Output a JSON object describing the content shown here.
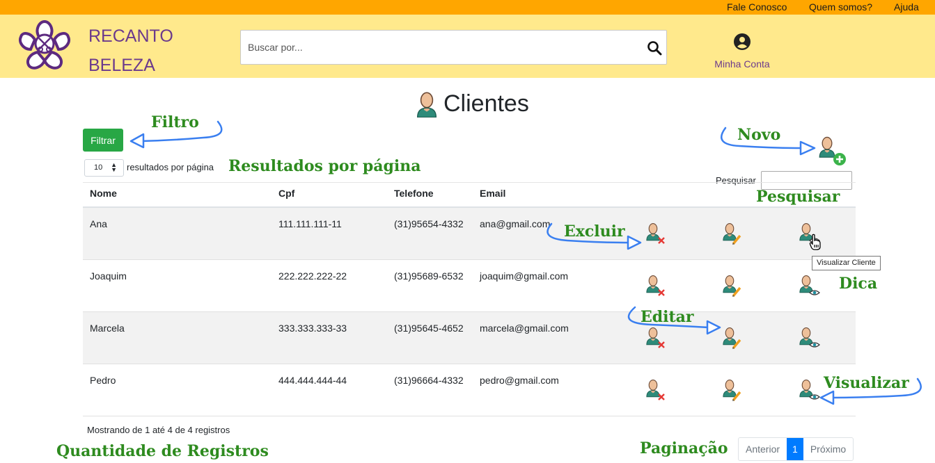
{
  "topbar": {
    "links": [
      "Fale Conosco",
      "Quem somos?",
      "Ajuda"
    ]
  },
  "brand": {
    "line1": "RECANTO",
    "line2": "BELEZA"
  },
  "search": {
    "placeholder": "Buscar por..."
  },
  "account": {
    "label": "Minha Conta"
  },
  "page": {
    "title": "Clientes"
  },
  "controls": {
    "filter_label": "Filtrar",
    "per_page_value": "10",
    "per_page_label": "resultados por página",
    "search_label": "Pesquisar"
  },
  "table": {
    "columns": [
      "Nome",
      "Cpf",
      "Telefone",
      "Email"
    ],
    "rows": [
      {
        "nome": "Ana",
        "cpf": "111.111.111-11",
        "telefone": "(31)95654-4332",
        "email": "ana@gmail.com"
      },
      {
        "nome": "Joaquim",
        "cpf": "222.222.222-22",
        "telefone": "(31)95689-6532",
        "email": "joaquim@gmail.com"
      },
      {
        "nome": "Marcela",
        "cpf": "333.333.333-33",
        "telefone": "(31)95645-4652",
        "email": "marcela@gmail.com"
      },
      {
        "nome": "Pedro",
        "cpf": "444.444.444-44",
        "telefone": "(31)96664-4332",
        "email": "pedro@gmail.com"
      }
    ]
  },
  "footer": {
    "info": "Mostrando de 1 até 4 de 4 registros"
  },
  "pagination": {
    "prev": "Anterior",
    "current": "1",
    "next": "Próximo"
  },
  "tooltip": "Visualizar Cliente",
  "annotations": {
    "filtro": "Filtro",
    "novo": "Novo",
    "resultados": "Resultados por página",
    "pesquisar": "Pesquisar",
    "excluir": "Excluir",
    "dica": "Dica",
    "editar": "Editar",
    "visualizar": "Visualizar",
    "quantidade": "Quantidade de Registros",
    "paginacao": "Paginação"
  },
  "colors": {
    "topbar": "#ffa600",
    "header": "#ffe98c",
    "brand": "#6b3a8c",
    "filter_button": "#28a745",
    "annotation": "#2e8b1f",
    "arrow": "#3a7ff0",
    "page_active": "#007bff"
  },
  "icons": [
    "search-icon",
    "account-icon",
    "person-icon",
    "add-person-icon",
    "delete-person-icon",
    "edit-person-icon",
    "view-person-icon"
  ]
}
